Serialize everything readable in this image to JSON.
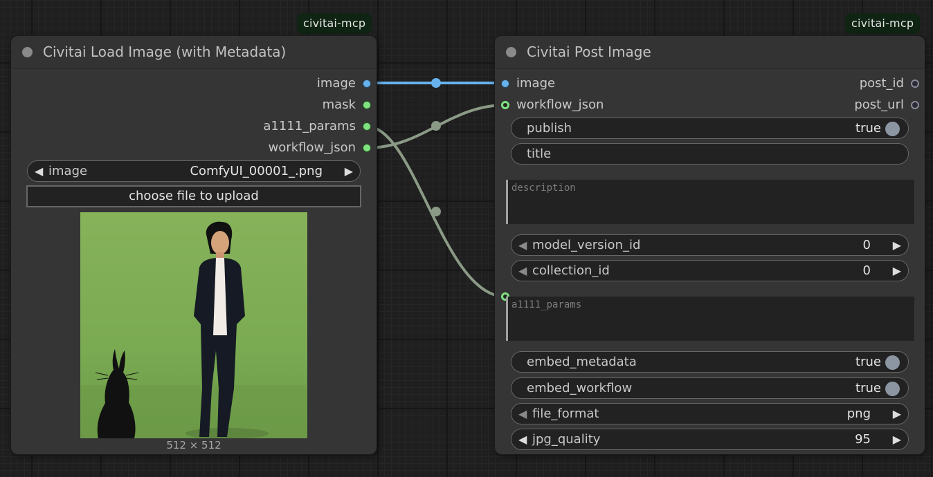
{
  "nodes": {
    "load": {
      "badge": "civitai-mcp",
      "title": "Civitai Load Image (with Metadata)",
      "outputs": [
        "image",
        "mask",
        "a1111_params",
        "workflow_json"
      ],
      "image_widget": {
        "label": "image",
        "value": "ComfyUI_00001_.png"
      },
      "upload_label": "choose file to upload",
      "preview_dims": "512 × 512"
    },
    "post": {
      "badge": "civitai-mcp",
      "title": "Civitai Post Image",
      "inputs": [
        "image",
        "workflow_json"
      ],
      "outputs": [
        "post_id",
        "post_url"
      ],
      "publish": {
        "label": "publish",
        "value": "true"
      },
      "title_field": {
        "label": "title"
      },
      "description": {
        "placeholder": "description"
      },
      "model_version_id": {
        "label": "model_version_id",
        "value": "0"
      },
      "collection_id": {
        "label": "collection_id",
        "value": "0"
      },
      "a1111_params": {
        "placeholder": "a1111_params"
      },
      "embed_metadata": {
        "label": "embed_metadata",
        "value": "true"
      },
      "embed_workflow": {
        "label": "embed_workflow",
        "value": "true"
      },
      "file_format": {
        "label": "file_format",
        "value": "png"
      },
      "jpg_quality": {
        "label": "jpg_quality",
        "value": "95"
      }
    }
  },
  "colors": {
    "image_link": "#67b2ec",
    "data_link": "#8a9a86",
    "badge_bg": "#0f2412"
  },
  "icons": {
    "arrow_left": "◀",
    "arrow_right": "▶"
  }
}
